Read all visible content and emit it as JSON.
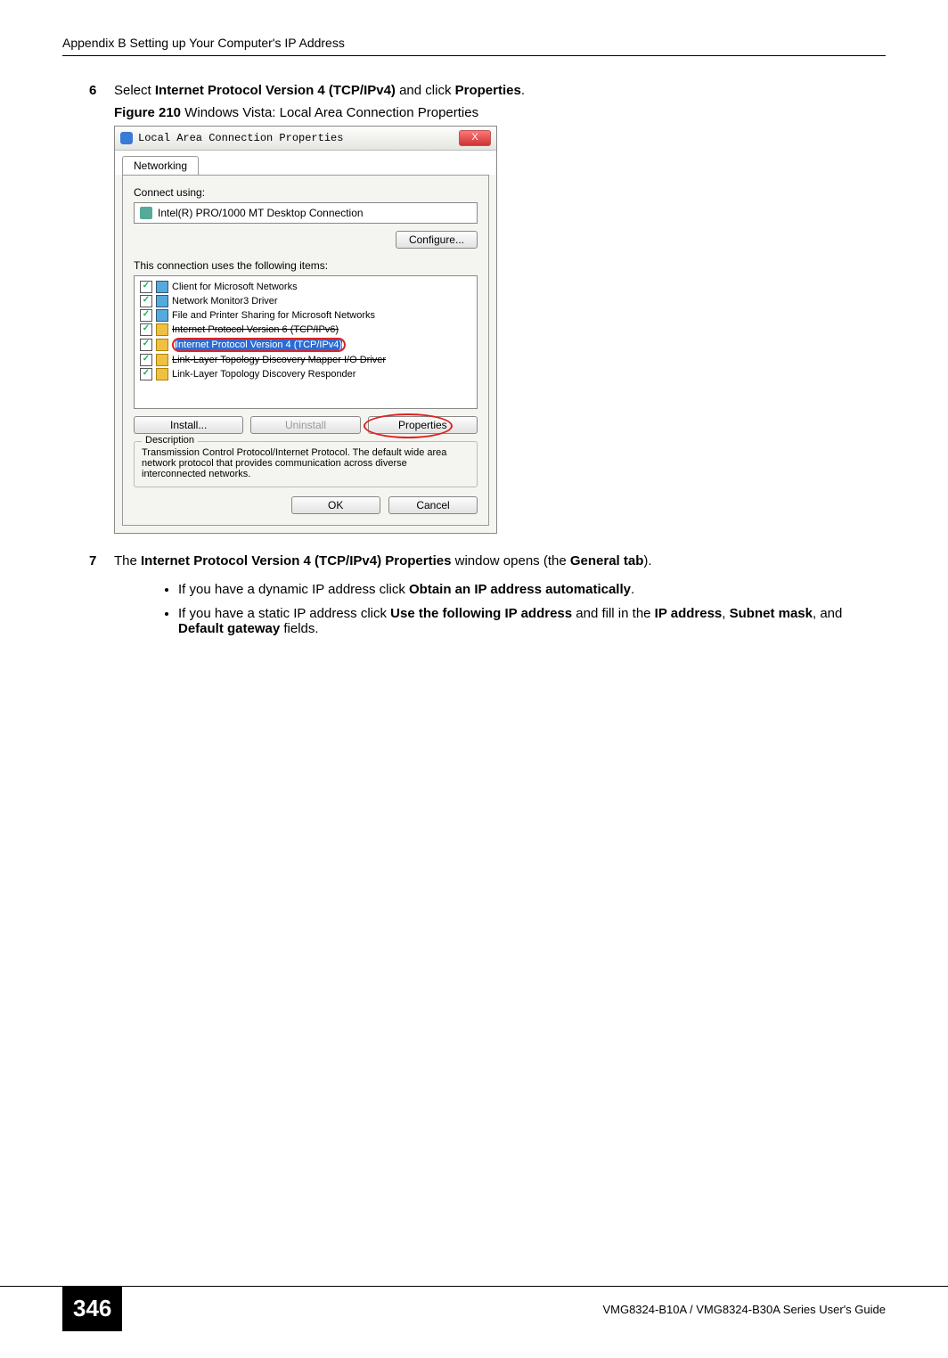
{
  "header": "Appendix B Setting up Your Computer's IP Address",
  "steps": {
    "s6": {
      "num": "6",
      "pre": "Select ",
      "bold": "Internet Protocol Version 4 (TCP/IPv4)",
      "mid": " and click ",
      "bold2": "Properties",
      "end": "."
    },
    "s7": {
      "num": "7",
      "pre": "The ",
      "bold": "Internet Protocol Version 4 (TCP/IPv4) Properties",
      "mid": " window opens (the ",
      "bold2": "General tab",
      "end": ")."
    }
  },
  "figure": {
    "label": "Figure 210",
    "caption": "   Windows Vista: Local Area Connection Properties"
  },
  "dialog": {
    "title": "Local Area Connection Properties",
    "close": "X",
    "tab": "Networking",
    "connect_using": "Connect using:",
    "adapter": "Intel(R) PRO/1000 MT Desktop Connection",
    "configure": "Configure...",
    "uses_label": "This connection uses the following items:",
    "items": [
      "Client for Microsoft Networks",
      "Network Monitor3 Driver",
      "File and Printer Sharing for Microsoft Networks",
      "Internet Protocol Version 6 (TCP/IPv6)",
      "Internet Protocol Version 4 (TCP/IPv4)",
      "Link-Layer Topology Discovery Mapper I/O Driver",
      "Link-Layer Topology Discovery Responder"
    ],
    "install": "Install...",
    "uninstall": "Uninstall",
    "properties": "Properties",
    "desc_label": "Description",
    "desc_text": "Transmission Control Protocol/Internet Protocol. The default wide area network protocol that provides communication across diverse interconnected networks.",
    "ok": "OK",
    "cancel": "Cancel"
  },
  "bullets": {
    "b1": {
      "pre": "If you have a dynamic IP address click ",
      "bold": "Obtain an IP address automatically",
      "end": "."
    },
    "b2": {
      "pre": "If you have a static IP address click ",
      "bold1": "Use the following IP address",
      "mid1": " and fill in the ",
      "bold2": "IP address",
      "mid2": ", ",
      "bold3": "Subnet mask",
      "mid3": ", and ",
      "bold4": "Default gateway",
      "end": " fields."
    }
  },
  "footer": {
    "page": "346",
    "guide": "VMG8324-B10A / VMG8324-B30A Series User's Guide"
  }
}
